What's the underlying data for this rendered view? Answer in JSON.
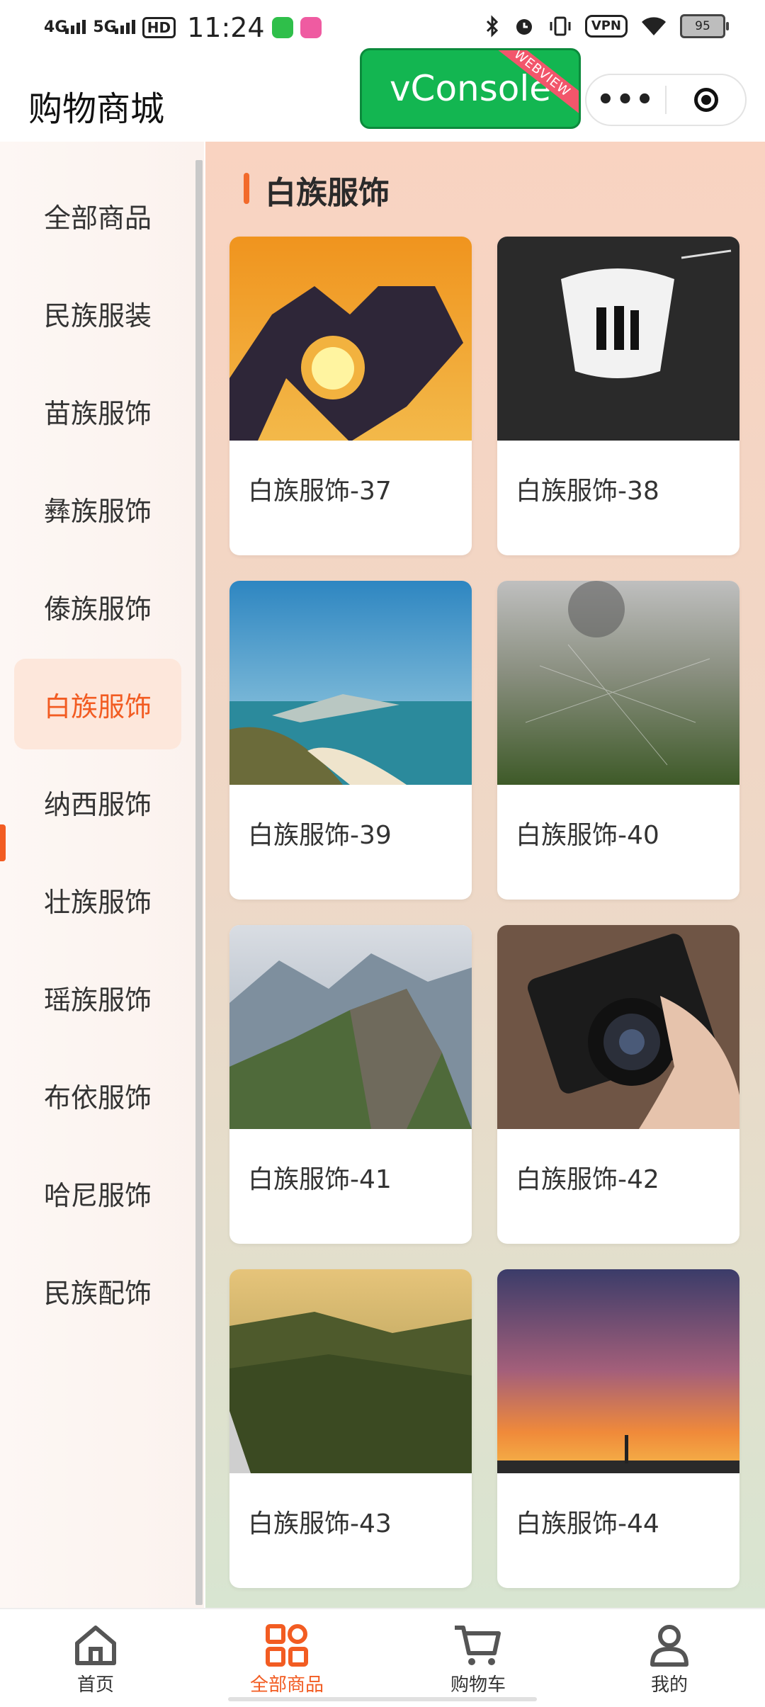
{
  "status_bar": {
    "net1": "4G",
    "net2": "5G",
    "hd": "HD",
    "time": "11:24",
    "vpn": "VPN",
    "battery": "95"
  },
  "title_bar": {
    "title": "购物商城",
    "vconsole_label": "vConsole",
    "vconsole_ribbon": "WEBVIEW"
  },
  "colors": {
    "accent": "#f25c22",
    "vconsole": "#13b651"
  },
  "sidebar": {
    "items": [
      {
        "label": "全部商品",
        "active": false
      },
      {
        "label": "民族服装",
        "active": false
      },
      {
        "label": "苗族服饰",
        "active": false
      },
      {
        "label": "彝族服饰",
        "active": false
      },
      {
        "label": "傣族服饰",
        "active": false
      },
      {
        "label": "白族服饰",
        "active": true
      },
      {
        "label": "纳西服饰",
        "active": false
      },
      {
        "label": "壮族服饰",
        "active": false
      },
      {
        "label": "瑶族服饰",
        "active": false
      },
      {
        "label": "布依服饰",
        "active": false
      },
      {
        "label": "哈尼服饰",
        "active": false
      },
      {
        "label": "民族配饰",
        "active": false
      }
    ]
  },
  "main": {
    "section_title": "白族服饰",
    "products": [
      {
        "name": "白族服饰-37",
        "image": "hands-heart-sunset"
      },
      {
        "name": "白族服饰-38",
        "image": "cave-silhouettes"
      },
      {
        "name": "白族服饰-39",
        "image": "coastline-beach"
      },
      {
        "name": "白族服饰-40",
        "image": "misty-field-web"
      },
      {
        "name": "白族服饰-41",
        "image": "mountain-ridge"
      },
      {
        "name": "白族服饰-42",
        "image": "hand-with-camera"
      },
      {
        "name": "白族服饰-43",
        "image": "forest-hills"
      },
      {
        "name": "白族服饰-44",
        "image": "sunset-sky"
      }
    ]
  },
  "tab_bar": {
    "tabs": [
      {
        "label": "首页",
        "icon": "home-icon",
        "active": false
      },
      {
        "label": "全部商品",
        "icon": "grid-icon",
        "active": true
      },
      {
        "label": "购物车",
        "icon": "cart-icon",
        "active": false
      },
      {
        "label": "我的",
        "icon": "user-icon",
        "active": false
      }
    ]
  }
}
